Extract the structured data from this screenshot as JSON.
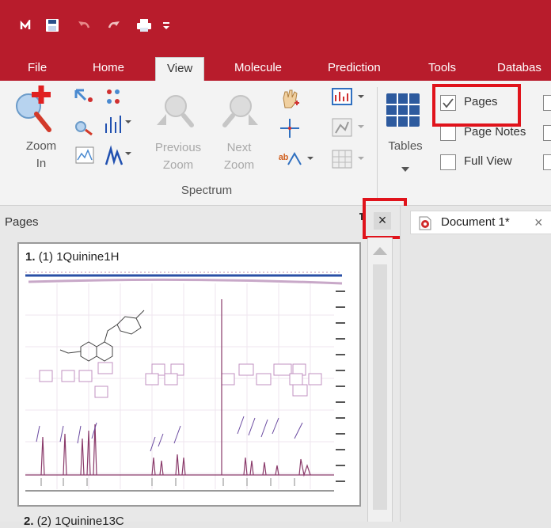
{
  "tabs": [
    {
      "label": "File"
    },
    {
      "label": "Home"
    },
    {
      "label": "View"
    },
    {
      "label": "Molecule"
    },
    {
      "label": "Prediction"
    },
    {
      "label": "Tools"
    },
    {
      "label": "Databas"
    }
  ],
  "ribbon": {
    "zoom_in": {
      "line1": "Zoom",
      "line2": "In"
    },
    "previous_zoom": {
      "line1": "Previous",
      "line2": "Zoom"
    },
    "next_zoom": {
      "line1": "Next",
      "line2": "Zoom"
    },
    "group_label": "Spectrum",
    "tables": "Tables",
    "checkboxes": [
      {
        "label": "Pages",
        "checked": true
      },
      {
        "label": "Page Notes",
        "checked": false
      },
      {
        "label": "Full View",
        "checked": false
      }
    ]
  },
  "pages_panel": {
    "title": "Pages",
    "close_glyph": "×",
    "page1": {
      "number": "1.",
      "title": "(1) 1Quinine1H"
    },
    "page2": {
      "number": "2.",
      "title": "(2) 1Quinine13C"
    }
  },
  "document": {
    "tab_label": "Document 1*",
    "close_glyph": "×"
  },
  "colors": {
    "title_bar": "#b81c2c",
    "highlight": "#e0131b",
    "spectrum_line": "#8a3a6a"
  }
}
